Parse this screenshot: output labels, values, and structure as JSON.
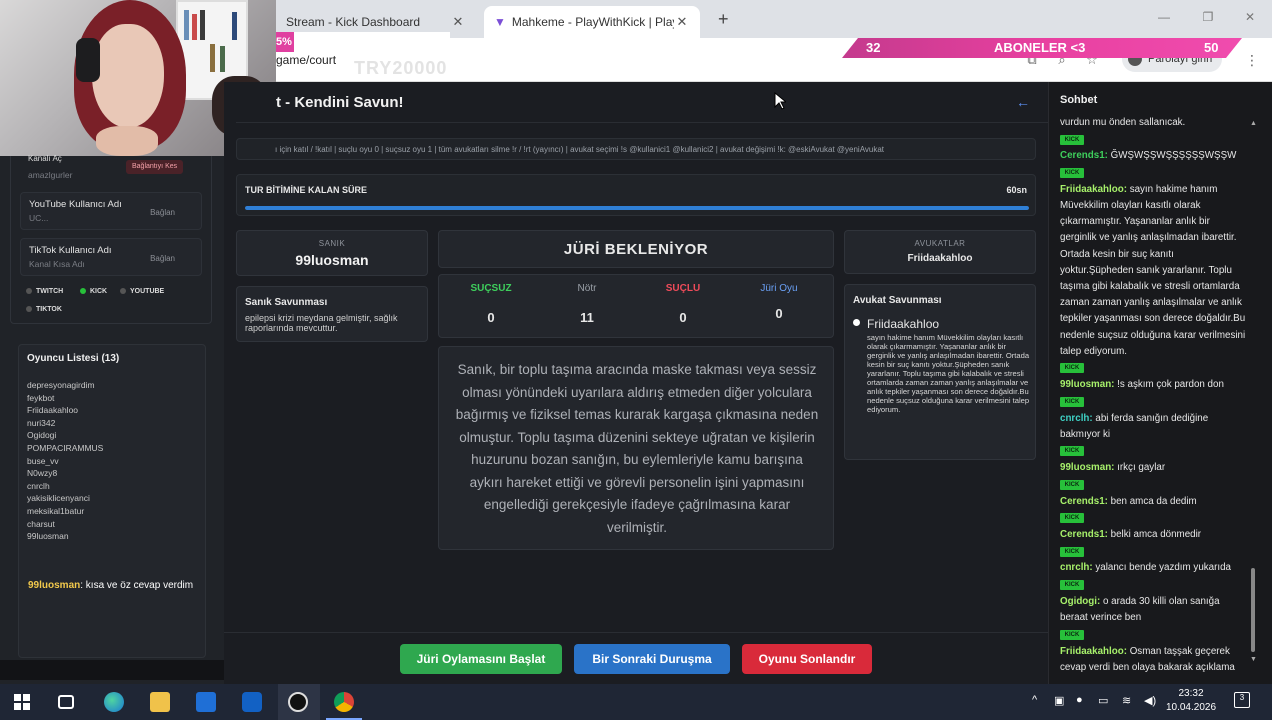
{
  "browser": {
    "tabs": [
      {
        "title": "Stream - Kick Dashboard",
        "active": false
      },
      {
        "title": "Mahkeme - PlayWithKick | Play",
        "active": true
      }
    ],
    "url": "game/court",
    "password_chip": "Parolayı girin"
  },
  "overlay": {
    "percent_badge": "5%",
    "promo_code": "TRY20000",
    "sub_goal": {
      "current": "32",
      "label": "ABONELER <3",
      "target": "50"
    },
    "ticker": {
      "user": "99luosman",
      "text": ": kısa ve öz cevap verdim"
    }
  },
  "left_panel": {
    "kick_partial": "Kanalı Aç",
    "kick_partial_sub": "amazlgurler",
    "connect_btn": "Bağlantıyı Kes",
    "youtube": {
      "title": "YouTube Kullanıcı Adı",
      "sub": "UC...",
      "btn": "Bağlan"
    },
    "tiktok": {
      "title": "TikTok Kullanıcı Adı",
      "sub": "Kanal Kısa Adı",
      "btn": "Bağlan"
    },
    "platforms": [
      "TWITCH",
      "KICK",
      "YOUTUBE",
      "TIKTOK"
    ],
    "players_title": "Oyuncu Listesi (13)",
    "players": [
      "depresyonagirdim",
      "feykbot",
      "Friidaakahloo",
      "nuri342",
      "Ogidogi",
      "POMPACIRAMMUS",
      "buse_vv",
      "N0wzy8",
      "cnrclh",
      "yakisiklicenyanci",
      "meksikal1batur",
      "charsut",
      "99luosman"
    ]
  },
  "main": {
    "title": "t - Kendini Savun!",
    "commands": "ı için katıl / !katıl | suçlu oyu 0 | suçsuz oyu 1 | tüm avukatları silme !r / !rt (yayıncı) | avukat seçimi !s @kullanici1 @kullanici2 | avukat değişimi !k: @eskiAvukat @yeniAvukat",
    "timer_label": "TUR BİTİMİNE KALAN SÜRE",
    "timer_value": "60sn",
    "timer_fraction": 1.0,
    "defendant_label": "SANIK",
    "defendant_name": "99luosman",
    "defense_label": "Sanık Savunması",
    "defense_text": "epilepsi krizi meydana gelmiştir, sağlık raporlarında mevcuttur.",
    "jury_status": "JÜRİ BEKLENİYOR",
    "votes": [
      {
        "label": "SUÇSUZ",
        "value": "0",
        "color": "#3ecf5c"
      },
      {
        "label": "Nötr",
        "value": "11",
        "color": "#9aa0a8"
      },
      {
        "label": "SUÇLU",
        "value": "0",
        "color": "#ef4b5a"
      },
      {
        "label": "Jüri Oyu",
        "value": "0",
        "color": "#6aa0f5"
      }
    ],
    "verdict_text": "Sanık, bir toplu taşıma aracında maske takması veya sessiz olması yönündeki uyarılara aldırış etmeden diğer yolculara bağırmış ve fiziksel temas kurarak kargaşa çıkmasına neden olmuştur. Toplu taşıma düzenini sekteye uğratan ve kişilerin huzurunu bozan sanığın, bu eylemleriyle kamu barışına aykırı hareket ettiği ve görevli personelin işini yapmasını engellediği gerekçesiyle ifadeye çağrılmasına karar verilmiştir.",
    "lawyers_label": "AVUKATLAR",
    "lawyers_name": "Friidaakahloo",
    "lawyer_defense_label": "Avukat Savunması",
    "lawyer_name": "Friidaakahloo",
    "lawyer_text": "sayın hakime hanım Müvekkilim olayları kasıtlı olarak çıkarmamıştır. Yaşananlar anlık bir gerginlik ve yanlış anlaşılmadan ibarettir. Ortada kesin bir suç kanıtı yoktur.Şüpheden sanık yararlanır. Toplu taşıma gibi kalabalık ve stresli ortamlarda zaman zaman yanlış anlaşılmalar ve anlık tepkiler yaşanması son derece doğaldır.Bu nedenle suçsuz olduğuna karar verilmesini talep ediyorum.",
    "buttons": {
      "start_vote": "Jüri Oylamasını Başlat",
      "next_hearing": "Bir Sonraki Duruşma",
      "end_game": "Oyunu Sonlandır"
    }
  },
  "chat": {
    "title": "Sohbet",
    "badge": "KICK",
    "messages": [
      {
        "user": "",
        "text": "vurdun mu önden sallanıcak.",
        "color": "#e8e8e8"
      },
      {
        "user": "Cerends1",
        "text": "ĞWŞWŞŞWŞŞŞŞŞŞWŞŞW",
        "color": "#3ecf5c"
      },
      {
        "user": "Friidaakahloo",
        "text": "sayın hakime hanım Müvekkilim olayları kasıtlı olarak çıkarmamıştır. Yaşananlar anlık bir gerginlik ve yanlış anlaşılmadan ibarettir. Ortada kesin bir suç kanıtı yoktur.Şüpheden sanık yararlanır. Toplu taşıma gibi kalabalık ve stresli ortamlarda zaman zaman yanlış anlaşılmalar ve anlık tepkiler yaşanması son derece doğaldır.Bu nedenle suçsuz olduğuna karar verilmesini talep ediyorum.",
        "color": "#a7f06b"
      },
      {
        "user": "99luosman",
        "text": "!s aşkım çok pardon don",
        "color": "#a7f06b"
      },
      {
        "user": "cnrclh",
        "text": "abi ferda sanığın dediğine bakmıyor ki",
        "color": "#3fd0c4"
      },
      {
        "user": "99luosman",
        "text": "ırkçı gaylar",
        "color": "#a7f06b"
      },
      {
        "user": "Cerends1",
        "text": "ben amca da dedim",
        "color": "#a7f06b"
      },
      {
        "user": "Cerends1",
        "text": "belki amca dönmedir",
        "color": "#a7f06b"
      },
      {
        "user": "cnrclh",
        "text": "yalancı bende yazdım yukarıda",
        "color": "#a7f06b"
      },
      {
        "user": "Ogidogi",
        "text": "o arada 30 killi olan sanığa beraat verince ben",
        "color": "#a7f06b"
      },
      {
        "user": "Friidaakahloo",
        "text": "Osman taşşak geçerek cevap verdi ben olaya bakarak açıklama yaptım",
        "color": "#a7f06b"
      },
      {
        "user": "99luosman",
        "text": "kısa ve öz cevap verdim",
        "color": "#a7f06b"
      }
    ]
  },
  "taskbar": {
    "time": "23:32",
    "date": "10.04.2026",
    "notifications": "3"
  }
}
